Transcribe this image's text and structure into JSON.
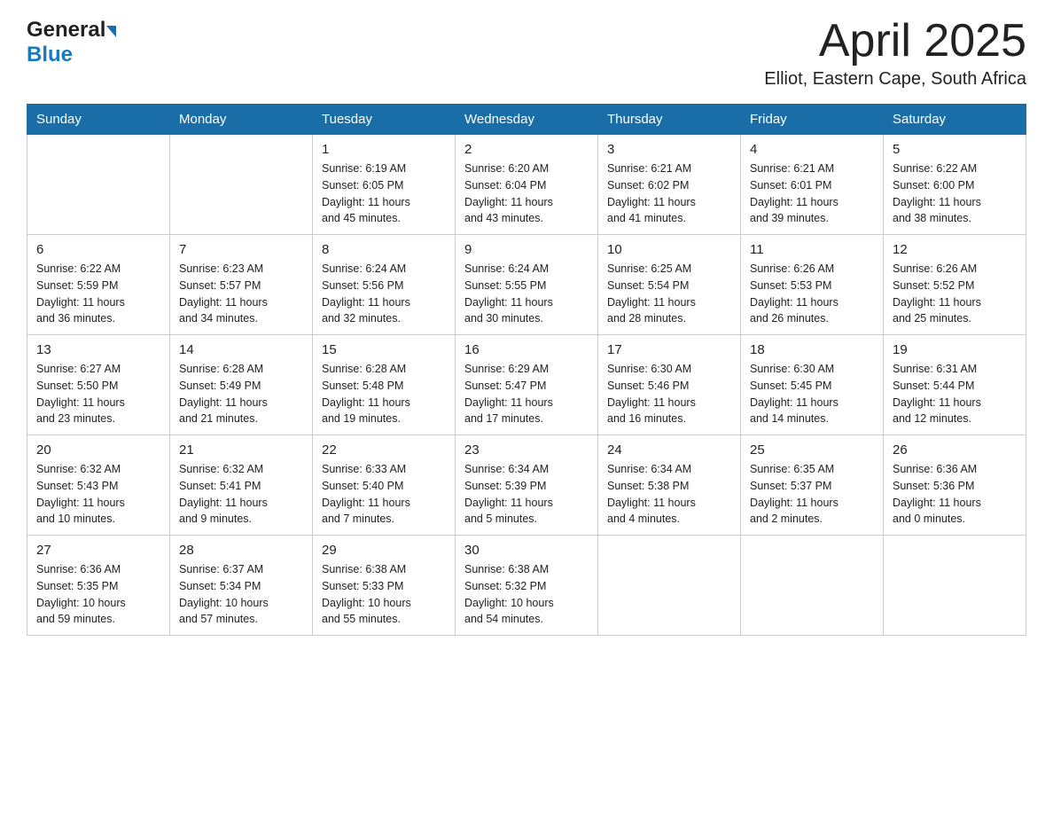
{
  "header": {
    "logo_general": "General",
    "logo_blue": "Blue",
    "month_title": "April 2025",
    "location": "Elliot, Eastern Cape, South Africa"
  },
  "weekdays": [
    "Sunday",
    "Monday",
    "Tuesday",
    "Wednesday",
    "Thursday",
    "Friday",
    "Saturday"
  ],
  "weeks": [
    [
      {
        "day": "",
        "info": ""
      },
      {
        "day": "",
        "info": ""
      },
      {
        "day": "1",
        "info": "Sunrise: 6:19 AM\nSunset: 6:05 PM\nDaylight: 11 hours\nand 45 minutes."
      },
      {
        "day": "2",
        "info": "Sunrise: 6:20 AM\nSunset: 6:04 PM\nDaylight: 11 hours\nand 43 minutes."
      },
      {
        "day": "3",
        "info": "Sunrise: 6:21 AM\nSunset: 6:02 PM\nDaylight: 11 hours\nand 41 minutes."
      },
      {
        "day": "4",
        "info": "Sunrise: 6:21 AM\nSunset: 6:01 PM\nDaylight: 11 hours\nand 39 minutes."
      },
      {
        "day": "5",
        "info": "Sunrise: 6:22 AM\nSunset: 6:00 PM\nDaylight: 11 hours\nand 38 minutes."
      }
    ],
    [
      {
        "day": "6",
        "info": "Sunrise: 6:22 AM\nSunset: 5:59 PM\nDaylight: 11 hours\nand 36 minutes."
      },
      {
        "day": "7",
        "info": "Sunrise: 6:23 AM\nSunset: 5:57 PM\nDaylight: 11 hours\nand 34 minutes."
      },
      {
        "day": "8",
        "info": "Sunrise: 6:24 AM\nSunset: 5:56 PM\nDaylight: 11 hours\nand 32 minutes."
      },
      {
        "day": "9",
        "info": "Sunrise: 6:24 AM\nSunset: 5:55 PM\nDaylight: 11 hours\nand 30 minutes."
      },
      {
        "day": "10",
        "info": "Sunrise: 6:25 AM\nSunset: 5:54 PM\nDaylight: 11 hours\nand 28 minutes."
      },
      {
        "day": "11",
        "info": "Sunrise: 6:26 AM\nSunset: 5:53 PM\nDaylight: 11 hours\nand 26 minutes."
      },
      {
        "day": "12",
        "info": "Sunrise: 6:26 AM\nSunset: 5:52 PM\nDaylight: 11 hours\nand 25 minutes."
      }
    ],
    [
      {
        "day": "13",
        "info": "Sunrise: 6:27 AM\nSunset: 5:50 PM\nDaylight: 11 hours\nand 23 minutes."
      },
      {
        "day": "14",
        "info": "Sunrise: 6:28 AM\nSunset: 5:49 PM\nDaylight: 11 hours\nand 21 minutes."
      },
      {
        "day": "15",
        "info": "Sunrise: 6:28 AM\nSunset: 5:48 PM\nDaylight: 11 hours\nand 19 minutes."
      },
      {
        "day": "16",
        "info": "Sunrise: 6:29 AM\nSunset: 5:47 PM\nDaylight: 11 hours\nand 17 minutes."
      },
      {
        "day": "17",
        "info": "Sunrise: 6:30 AM\nSunset: 5:46 PM\nDaylight: 11 hours\nand 16 minutes."
      },
      {
        "day": "18",
        "info": "Sunrise: 6:30 AM\nSunset: 5:45 PM\nDaylight: 11 hours\nand 14 minutes."
      },
      {
        "day": "19",
        "info": "Sunrise: 6:31 AM\nSunset: 5:44 PM\nDaylight: 11 hours\nand 12 minutes."
      }
    ],
    [
      {
        "day": "20",
        "info": "Sunrise: 6:32 AM\nSunset: 5:43 PM\nDaylight: 11 hours\nand 10 minutes."
      },
      {
        "day": "21",
        "info": "Sunrise: 6:32 AM\nSunset: 5:41 PM\nDaylight: 11 hours\nand 9 minutes."
      },
      {
        "day": "22",
        "info": "Sunrise: 6:33 AM\nSunset: 5:40 PM\nDaylight: 11 hours\nand 7 minutes."
      },
      {
        "day": "23",
        "info": "Sunrise: 6:34 AM\nSunset: 5:39 PM\nDaylight: 11 hours\nand 5 minutes."
      },
      {
        "day": "24",
        "info": "Sunrise: 6:34 AM\nSunset: 5:38 PM\nDaylight: 11 hours\nand 4 minutes."
      },
      {
        "day": "25",
        "info": "Sunrise: 6:35 AM\nSunset: 5:37 PM\nDaylight: 11 hours\nand 2 minutes."
      },
      {
        "day": "26",
        "info": "Sunrise: 6:36 AM\nSunset: 5:36 PM\nDaylight: 11 hours\nand 0 minutes."
      }
    ],
    [
      {
        "day": "27",
        "info": "Sunrise: 6:36 AM\nSunset: 5:35 PM\nDaylight: 10 hours\nand 59 minutes."
      },
      {
        "day": "28",
        "info": "Sunrise: 6:37 AM\nSunset: 5:34 PM\nDaylight: 10 hours\nand 57 minutes."
      },
      {
        "day": "29",
        "info": "Sunrise: 6:38 AM\nSunset: 5:33 PM\nDaylight: 10 hours\nand 55 minutes."
      },
      {
        "day": "30",
        "info": "Sunrise: 6:38 AM\nSunset: 5:32 PM\nDaylight: 10 hours\nand 54 minutes."
      },
      {
        "day": "",
        "info": ""
      },
      {
        "day": "",
        "info": ""
      },
      {
        "day": "",
        "info": ""
      }
    ]
  ]
}
